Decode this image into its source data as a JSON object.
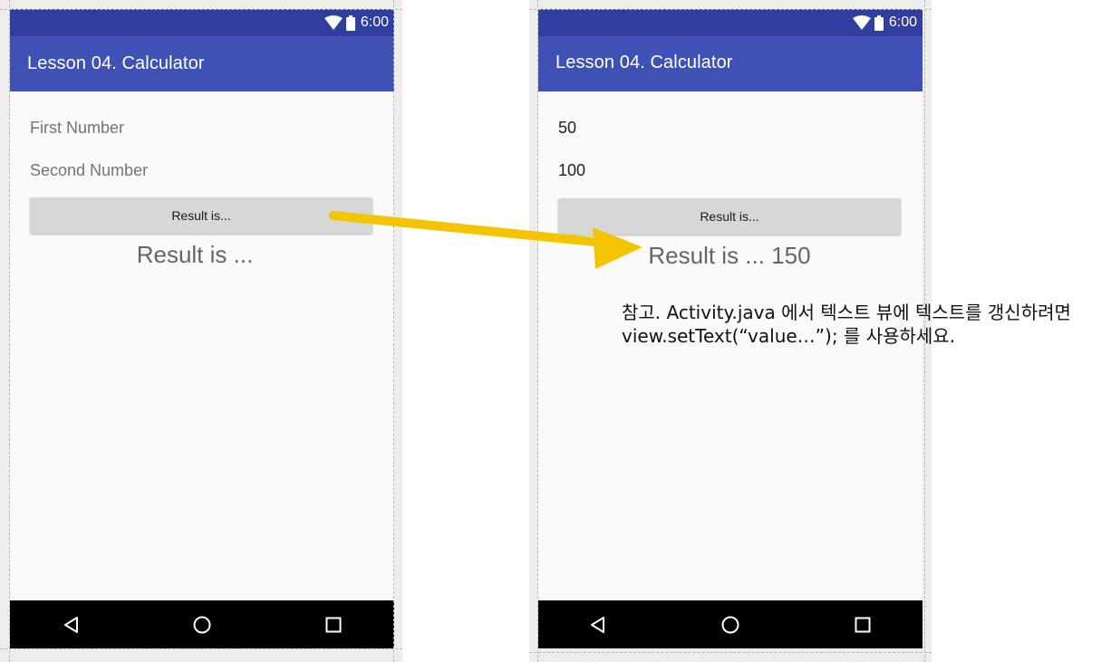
{
  "left_phone": {
    "status_time": "6:00",
    "app_title": "Lesson 04. Calculator",
    "first_number": {
      "value": "",
      "placeholder": "First Number"
    },
    "second_number": {
      "value": "",
      "placeholder": "Second Number"
    },
    "button_label": "Result is...",
    "result_text": "Result is ..."
  },
  "right_phone": {
    "status_time": "6:00",
    "app_title": "Lesson 04. Calculator",
    "first_number": {
      "value": "50",
      "placeholder": ""
    },
    "second_number": {
      "value": "100",
      "placeholder": ""
    },
    "button_label": "Result is...",
    "result_text": "Result is ... 150"
  },
  "annotation": {
    "line1": "참고. Activity.java 에서 텍스트 뷰에 텍스트를 갱신하려면",
    "line2": "view.setText(“value…”); 를 사용하세요.",
    "arrow_color": "#f5c400"
  },
  "icons": [
    "wifi-icon",
    "battery-icon",
    "back-icon",
    "home-icon",
    "recents-icon"
  ],
  "colors": {
    "status_bar": "#303f9f",
    "app_bar": "#3f51b5",
    "screen_bg": "#fafafa",
    "nav_bar": "#000000",
    "button_bg": "#d6d7d7"
  }
}
